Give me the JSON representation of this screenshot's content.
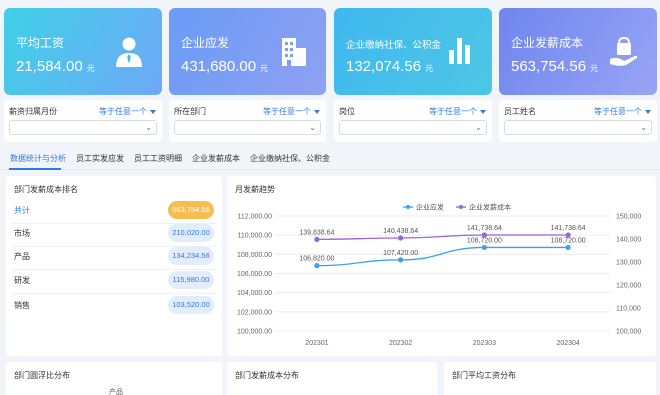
{
  "kpis": [
    {
      "title": "平均工资",
      "value": "21,584.00",
      "unit": "元",
      "icon": "person-tie-icon"
    },
    {
      "title": "企业应发",
      "value": "431,680.00",
      "unit": "元",
      "icon": "building-icon"
    },
    {
      "title": "企业缴纳社保、公积金",
      "value": "132,074.56",
      "unit": "元",
      "icon": "bar-chart-icon"
    },
    {
      "title": "企业发薪成本",
      "value": "563,754.56",
      "unit": "元",
      "icon": "hand-bag-icon"
    }
  ],
  "filters": [
    {
      "label": "薪资归属月份",
      "operator": "等于任意一个"
    },
    {
      "label": "所在部门",
      "operator": "等于任意一个"
    },
    {
      "label": "岗位",
      "operator": "等于任意一个"
    },
    {
      "label": "员工姓名",
      "operator": "等于任意一个"
    }
  ],
  "tabs": [
    "数据统计与分析",
    "员工实发应发",
    "员工工资明细",
    "企业发薪成本",
    "企业缴纳社保、公积金"
  ],
  "ranking": {
    "title": "部门发薪成本排名",
    "rows": [
      {
        "name": "共计",
        "value": "563,754.56"
      },
      {
        "name": "市场",
        "value": "210,020.00"
      },
      {
        "name": "产品",
        "value": "134,234.56"
      },
      {
        "name": "研发",
        "value": "115,980.00"
      },
      {
        "name": "销售",
        "value": "103,520.00"
      }
    ]
  },
  "trend_title": "月发薪趋势",
  "bottom_panels": {
    "p1_title": "部门圆浮比分布",
    "p1_label": "产品",
    "p2_title": "部门发薪成本分布",
    "p3_title": "部门平均工资分布"
  },
  "colors": {
    "accent": "#2f7ae5",
    "series_blue": "#3ea0ea",
    "series_purple": "#9b63d6",
    "total_pill": "#f6be52"
  },
  "chart_data": {
    "type": "line",
    "x": [
      "202301",
      "202302",
      "202303",
      "202304"
    ],
    "series": [
      {
        "name": "企业应发",
        "axis": "left",
        "values": [
          106820.0,
          107420.0,
          108720.0,
          108720.0
        ],
        "labels": [
          "106,820.00",
          "107,420.00",
          "108,720.00",
          "108,720.00"
        ],
        "color": "#3ea0ea"
      },
      {
        "name": "企业发薪成本",
        "axis": "right",
        "values": [
          139838.64,
          140438.64,
          141738.64,
          141738.64
        ],
        "labels": [
          "139,838.64",
          "140,438.64",
          "141,738.64",
          "141,738.64"
        ],
        "color": "#9b63d6"
      }
    ],
    "y_left": {
      "min": 100000,
      "max": 112000,
      "ticks": [
        "100,000.00",
        "102,000.00",
        "104,000.00",
        "106,000.00",
        "108,000.00",
        "110,000.00",
        "112,000.00"
      ]
    },
    "y_right": {
      "min": 100000,
      "max": 150000,
      "ticks": [
        "100,000",
        "110,000",
        "120,000",
        "130,000",
        "140,000",
        "150,000"
      ]
    },
    "legend": "top-center",
    "grid": true
  }
}
